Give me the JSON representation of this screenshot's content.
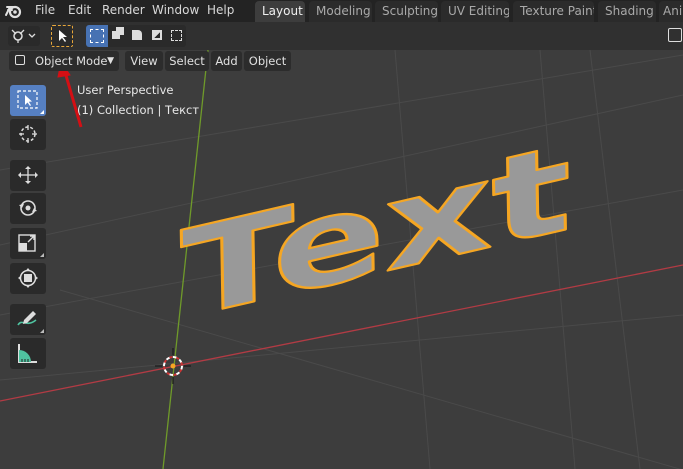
{
  "menu": {
    "file": "File",
    "edit": "Edit",
    "render": "Render",
    "window": "Window",
    "help": "Help"
  },
  "workspaces": [
    {
      "label": "Layout",
      "active": true
    },
    {
      "label": "Modeling"
    },
    {
      "label": "Sculpting"
    },
    {
      "label": "UV Editing"
    },
    {
      "label": "Texture Paint"
    },
    {
      "label": "Shading"
    },
    {
      "label": "Anim"
    }
  ],
  "header": {
    "mode": "Object Mode",
    "view": "View",
    "select": "Select",
    "add": "Add",
    "object": "Object"
  },
  "viewport": {
    "perspective": "User Perspective",
    "collection": "(1) Collection | Текст",
    "text_object": "Text"
  },
  "tools": [
    {
      "name": "select-box-tool",
      "active": true
    },
    {
      "name": "cursor-tool"
    },
    {
      "name": "move-tool"
    },
    {
      "name": "rotate-tool"
    },
    {
      "name": "scale-tool"
    },
    {
      "name": "transform-tool"
    },
    {
      "name": "annotate-tool"
    },
    {
      "name": "measure-tool"
    }
  ],
  "colors": {
    "accent": "#5680c2",
    "selection_outline": "#f5a623",
    "x_axis": "#b23b44",
    "y_axis": "#6f9a2a",
    "background": "#3d3d3d",
    "annotation_arrow": "#d40f14"
  }
}
